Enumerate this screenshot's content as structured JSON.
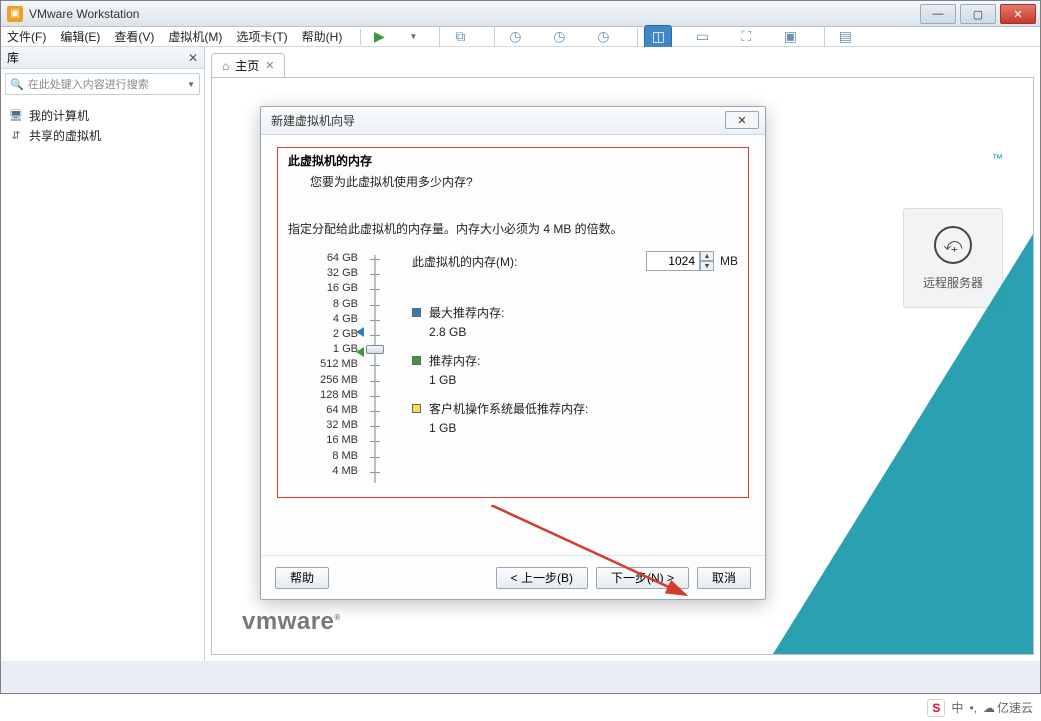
{
  "window": {
    "title": "VMware Workstation"
  },
  "menu": {
    "file": "文件(F)",
    "edit": "编辑(E)",
    "view": "查看(V)",
    "vm": "虚拟机(M)",
    "tabs": "选项卡(T)",
    "help": "帮助(H)"
  },
  "sidebar": {
    "title": "库",
    "search_placeholder": "在此处键入内容进行搜索",
    "items": [
      {
        "label": "我的计算机"
      },
      {
        "label": "共享的虚拟机"
      }
    ]
  },
  "tab": {
    "home": "主页"
  },
  "remote": {
    "label": "远程服务器",
    "tm": "™"
  },
  "brand": {
    "name": "vmware",
    "r": "®"
  },
  "dialog": {
    "title": "新建虚拟机向导",
    "header_title": "此虚拟机的内存",
    "header_sub": "您要为此虚拟机使用多少内存?",
    "instruction": "指定分配给此虚拟机的内存量。内存大小必须为 4 MB 的倍数。",
    "field_label": "此虚拟机的内存(M):",
    "field_value": "1024",
    "field_unit": "MB",
    "ticks": [
      "64 GB",
      "32 GB",
      "16 GB",
      "8 GB",
      "4 GB",
      "2 GB",
      "1 GB",
      "512 MB",
      "256 MB",
      "128 MB",
      "64 MB",
      "32 MB",
      "16 MB",
      "8 MB",
      "4 MB"
    ],
    "legend": {
      "max_label": "最大推荐内存:",
      "max_value": "2.8 GB",
      "rec_label": "推荐内存:",
      "rec_value": "1 GB",
      "min_label": "客户机操作系统最低推荐内存:",
      "min_value": "1 GB"
    },
    "buttons": {
      "help": "帮助",
      "back": "< 上一步(B)",
      "next": "下一步(N) >",
      "cancel": "取消"
    }
  },
  "taskbar": {
    "ime": "中",
    "sep": "•,",
    "cloud": "亿速云"
  }
}
